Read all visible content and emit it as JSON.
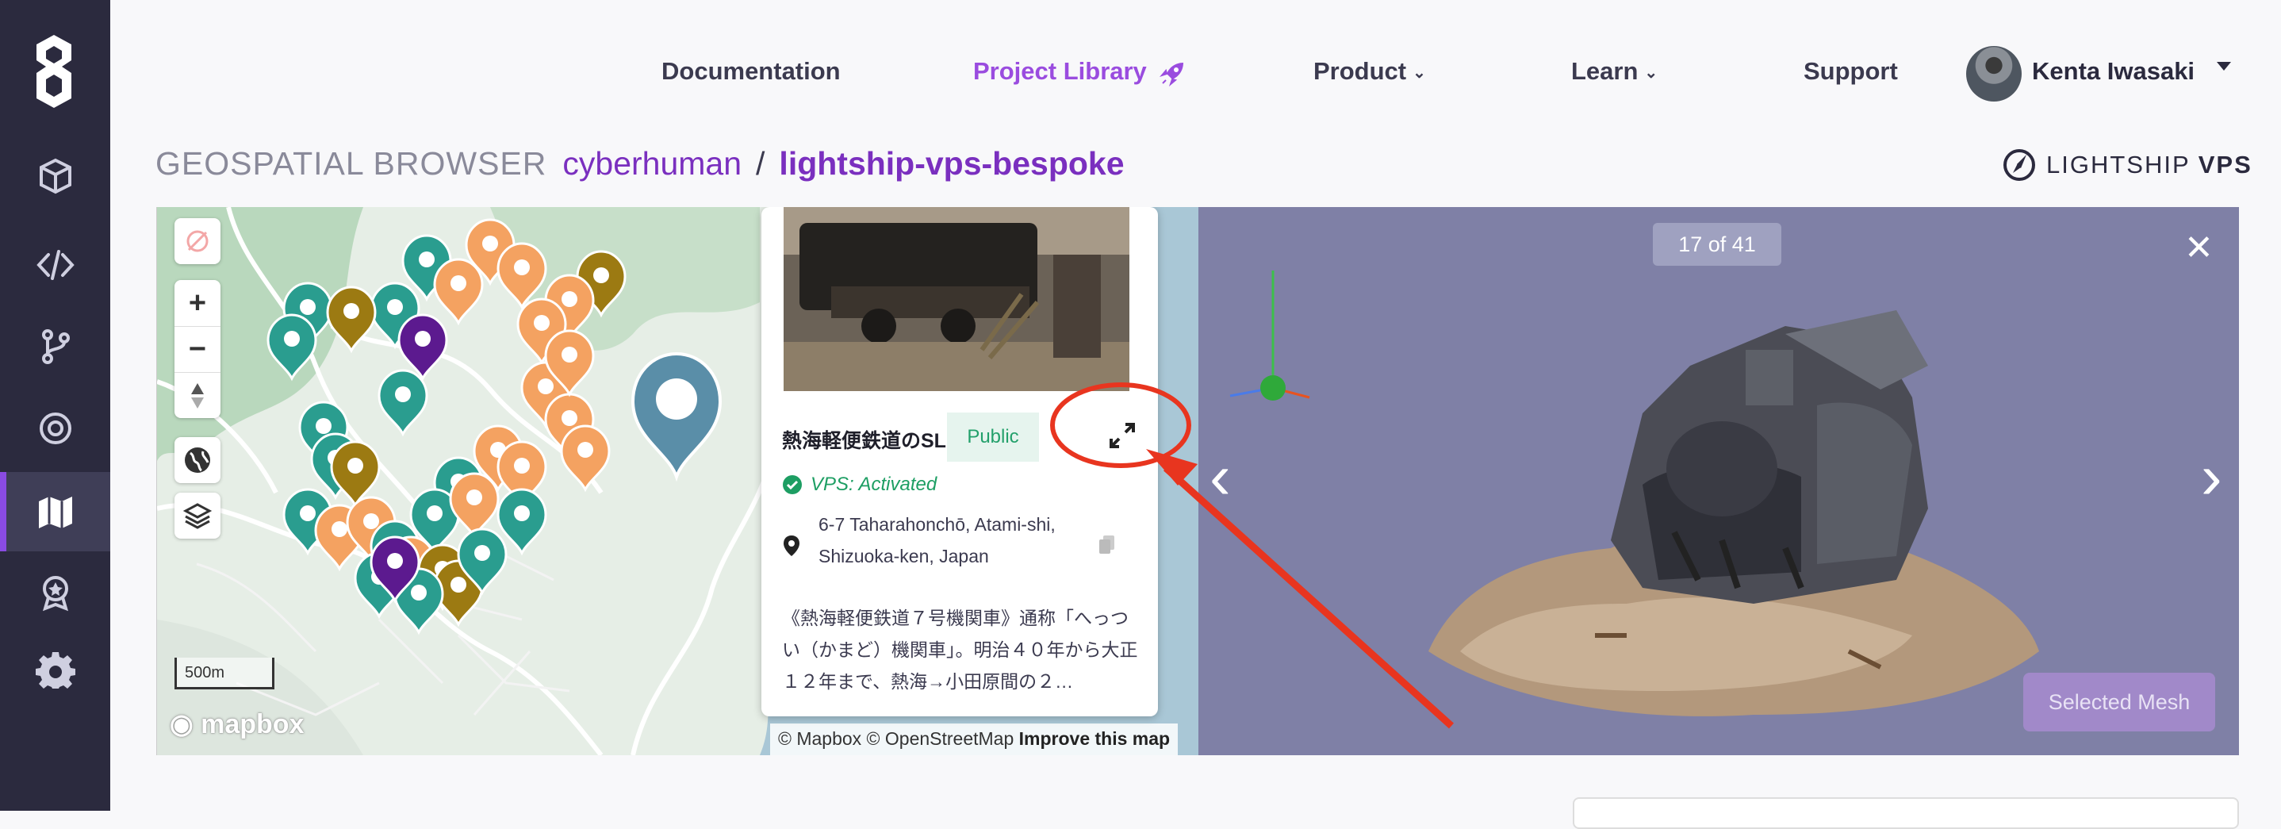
{
  "sidebar": {
    "items": [
      {
        "icon": "cube-icon",
        "active": false
      },
      {
        "icon": "code-icon",
        "active": false
      },
      {
        "icon": "branch-icon",
        "active": false
      },
      {
        "icon": "target-icon",
        "active": false
      },
      {
        "icon": "map-icon",
        "active": true
      },
      {
        "icon": "badge-icon",
        "active": false
      },
      {
        "icon": "gear-icon",
        "active": false
      }
    ]
  },
  "nav": {
    "documentation": "Documentation",
    "project_library": "Project Library",
    "product": "Product",
    "learn": "Learn",
    "support": "Support"
  },
  "user": {
    "name": "Kenta Iwasaki"
  },
  "breadcrumb": {
    "section": "GEOSPATIAL BROWSER",
    "org": "cyberhuman",
    "separator": "/",
    "project": "lightship-vps-bespoke"
  },
  "brand": {
    "light": "LIGHTSHIP",
    "bold": "VPS"
  },
  "map": {
    "scale_label": "500m",
    "logo_text": "mapbox",
    "attribution": "© Mapbox © OpenStreetMap",
    "improve_link": "Improve this map"
  },
  "popup": {
    "title": "熱海軽便鉄道のSL",
    "visibility": "Public",
    "vps_status": "VPS: Activated",
    "address_line1": "6-7 Taharahonchō, Atami-shi,",
    "address_line2": "Shizuoka-ken, Japan",
    "description": "《熱海軽便鉄道７号機関車》通称「へっつい（かまど）機関車」。明治４０年から大正１２年まで、熱海→小田原間の２…"
  },
  "viewer": {
    "counter": "17 of 41",
    "selected_mesh_label": "Selected Mesh"
  },
  "colors": {
    "sidebar_bg": "#2b2a3e",
    "accent_purple": "#7a2fbf",
    "teal_marker": "#2a9d8f",
    "orange_marker": "#f4a261",
    "olive_marker": "#9c7a12",
    "viewer_bg": "#7f80a6",
    "annotation_red": "#e8351f"
  }
}
